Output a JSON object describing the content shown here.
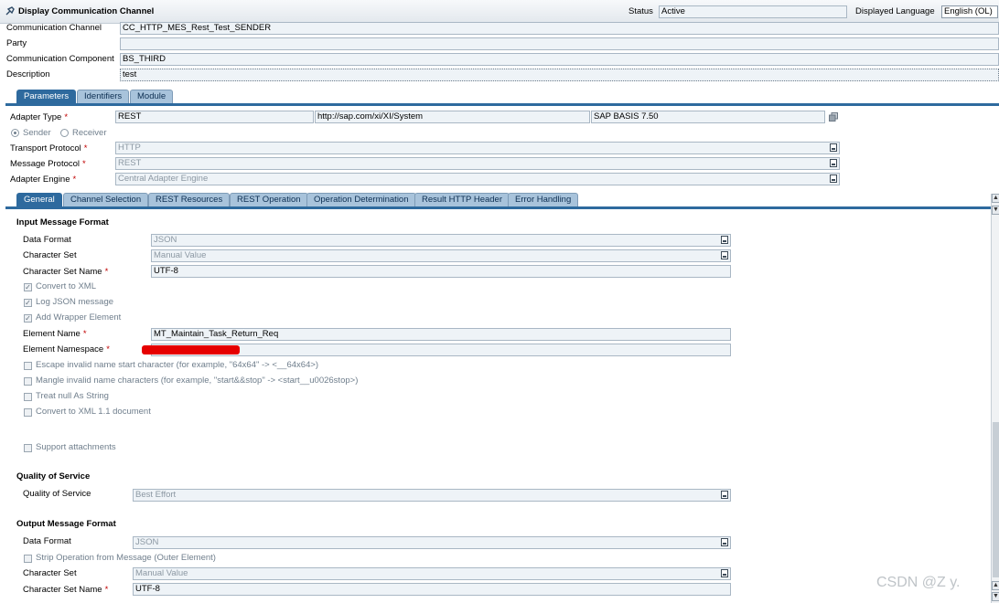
{
  "window": {
    "title": "Display Communication Channel",
    "status_label": "Status",
    "status_value": "Active",
    "lang_label": "Displayed Language",
    "lang_value": "English (OL)"
  },
  "header": {
    "comm_channel_label": "Communication Channel",
    "comm_channel_value": "CC_HTTP_MES_Rest_Test_SENDER",
    "party_label": "Party",
    "party_value": "",
    "comm_component_label": "Communication Component",
    "comm_component_value": "BS_THIRD",
    "description_label": "Description",
    "description_value": "test"
  },
  "main_tabs": [
    "Parameters",
    "Identifiers",
    "Module"
  ],
  "params": {
    "adapter_type_label": "Adapter Type",
    "adapter_type_value": "REST",
    "adapter_ns_value": "http://sap.com/xi/XI/System",
    "adapter_swcv_value": "SAP BASIS 7.50",
    "sender_label": "Sender",
    "receiver_label": "Receiver",
    "transport_label": "Transport Protocol",
    "transport_value": "HTTP",
    "message_label": "Message Protocol",
    "message_value": "REST",
    "engine_label": "Adapter Engine",
    "engine_value": "Central Adapter Engine"
  },
  "sub_tabs": [
    "General",
    "Channel Selection",
    "REST Resources",
    "REST Operation",
    "Operation Determination",
    "Result HTTP Header",
    "Error Handling"
  ],
  "input": {
    "title": "Input Message Format",
    "data_format_label": "Data Format",
    "data_format_value": "JSON",
    "charset_label": "Character Set",
    "charset_value": "Manual Value",
    "charset_name_label": "Character Set Name",
    "charset_name_value": "UTF-8",
    "convert_xml": "Convert to XML",
    "log_json": "Log JSON message",
    "add_wrapper": "Add Wrapper Element",
    "element_name_label": "Element Name",
    "element_name_value": "MT_Maintain_Task_Return_Req",
    "element_ns_label": "Element Namespace",
    "escape_invalid": "Escape invalid name start character (for example, \"64x64\" -> <__64x64>)",
    "mangle_invalid": "Mangle invalid name characters (for example, \"start&&stop\" -> <start__u0026stop>)",
    "treat_null": "Treat null As String",
    "convert_xml11": "Convert to XML 1.1 document",
    "support_attachments": "Support attachments"
  },
  "qos": {
    "title": "Quality of Service",
    "label": "Quality of Service",
    "value": "Best Effort"
  },
  "output": {
    "title": "Output Message Format",
    "data_format_label": "Data Format",
    "data_format_value": "JSON",
    "strip_operation": "Strip Operation from Message (Outer Element)",
    "charset_label": "Character Set",
    "charset_value": "Manual Value",
    "charset_name_label": "Character Set Name",
    "charset_name_value": "UTF-8"
  },
  "watermark": "CSDN @Z y. ",
  "colors": {
    "tab_active": "#2e6a9e",
    "tab_inactive": "#a8c3db",
    "field_bg": "#eef3f7",
    "required": "#c00000",
    "redaction": "#e60000"
  }
}
